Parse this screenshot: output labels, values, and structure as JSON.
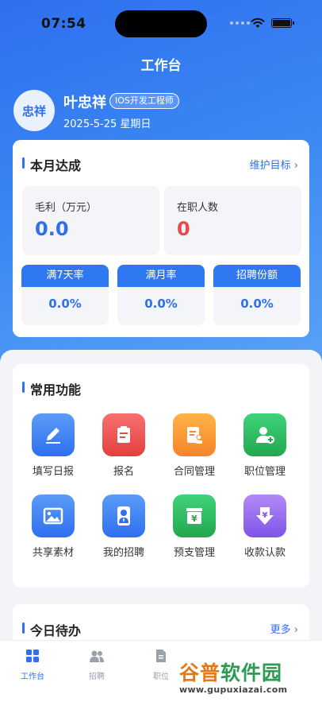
{
  "status_bar": {
    "time": "07:54"
  },
  "header": {
    "title": "工作台"
  },
  "profile": {
    "avatar_text": "忠祥",
    "name": "叶忠祥",
    "role": "IOS开发工程师",
    "date": "2025-5-25 星期日"
  },
  "monthly": {
    "title": "本月达成",
    "link": "维护目标",
    "gross_profit_label": "毛利（万元）",
    "gross_profit_value": "0.0",
    "staff_label": "在职人数",
    "staff_value": "0",
    "rates": [
      {
        "label": "满7天率",
        "value": "0.0%"
      },
      {
        "label": "满月率",
        "value": "0.0%"
      },
      {
        "label": "招聘份额",
        "value": "0.0%"
      }
    ]
  },
  "functions": {
    "title": "常用功能",
    "items": [
      {
        "label": "填写日报",
        "icon": "edit-icon"
      },
      {
        "label": "报名",
        "icon": "clipboard-icon"
      },
      {
        "label": "合同管理",
        "icon": "contract-icon"
      },
      {
        "label": "职位管理",
        "icon": "user-add-icon"
      },
      {
        "label": "共享素材",
        "icon": "image-icon"
      },
      {
        "label": "我的招聘",
        "icon": "person-tie-icon"
      },
      {
        "label": "预支管理",
        "icon": "yuan-box-icon"
      },
      {
        "label": "收款认款",
        "icon": "yuan-down-icon"
      }
    ]
  },
  "todo": {
    "title": "今日待办",
    "link": "更多"
  },
  "tabbar": {
    "items": [
      {
        "label": "工作台"
      },
      {
        "label": "招聘"
      },
      {
        "label": "职位"
      }
    ]
  },
  "watermark": {
    "brand_a": "谷普",
    "brand_b": "软件园",
    "url": "www.gupuxiazai.com"
  },
  "colors": {
    "primary": "#2f6ff0",
    "danger": "#e84a4a",
    "bg": "#f2f4f8"
  }
}
